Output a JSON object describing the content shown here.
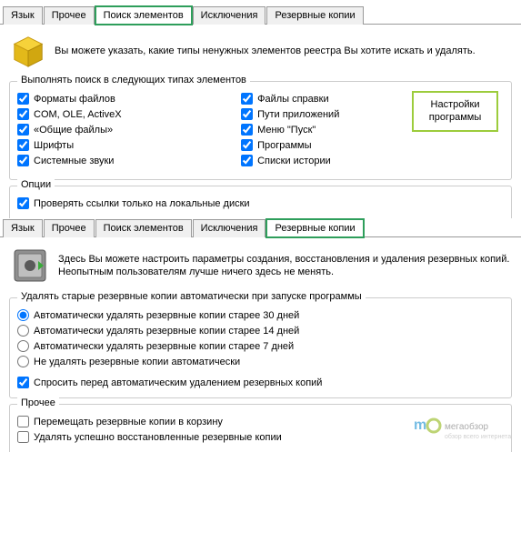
{
  "tabs1": {
    "lang": "Язык",
    "other": "Прочее",
    "search": "Поиск элементов",
    "excl": "Исключения",
    "backup": "Резервные копии"
  },
  "tabs2": {
    "lang": "Язык",
    "other": "Прочее",
    "search": "Поиск элементов",
    "excl": "Исключения",
    "backup": "Резервные копии"
  },
  "pane1": {
    "intro": "Вы можете указать, какие типы ненужных элементов реестра Вы хотите искать и удалять.",
    "group1_legend": "Выполнять поиск в следующих типах элементов",
    "cb_fileformats": "Форматы файлов",
    "cb_com": "COM, OLE, ActiveX",
    "cb_shared": "«Общие файлы»",
    "cb_fonts": "Шрифты",
    "cb_sounds": "Системные звуки",
    "cb_help": "Файлы справки",
    "cb_paths": "Пути приложений",
    "cb_startmenu": "Меню \"Пуск\"",
    "cb_programs": "Программы",
    "cb_history": "Списки истории",
    "settings_btn": "Настройки программы",
    "group2_legend": "Опции",
    "cb_localonly": "Проверять ссылки только на локальные диски"
  },
  "pane2": {
    "intro": "Здесь Вы можете настроить параметры создания, восстановления и удаления резервных копий. Неопытным пользователям лучше ничего здесь не менять.",
    "group1_legend": "Удалять старые резервные копии автоматически при запуске программы",
    "r30": "Автоматически удалять резервные копии старее 30 дней",
    "r14": "Автоматически удалять резервные копии старее 14 дней",
    "r7": "Автоматически удалять резервные копии старее 7 дней",
    "rno": "Не удалять резервные копии автоматически",
    "cb_ask": "Спросить перед автоматическим удалением резервных копий",
    "group2_legend": "Прочее",
    "cb_trash": "Перемещать резервные копии в корзину",
    "cb_delok": "Удалять успешно восстановленные резервные копии"
  },
  "watermark": "мегаобзор"
}
